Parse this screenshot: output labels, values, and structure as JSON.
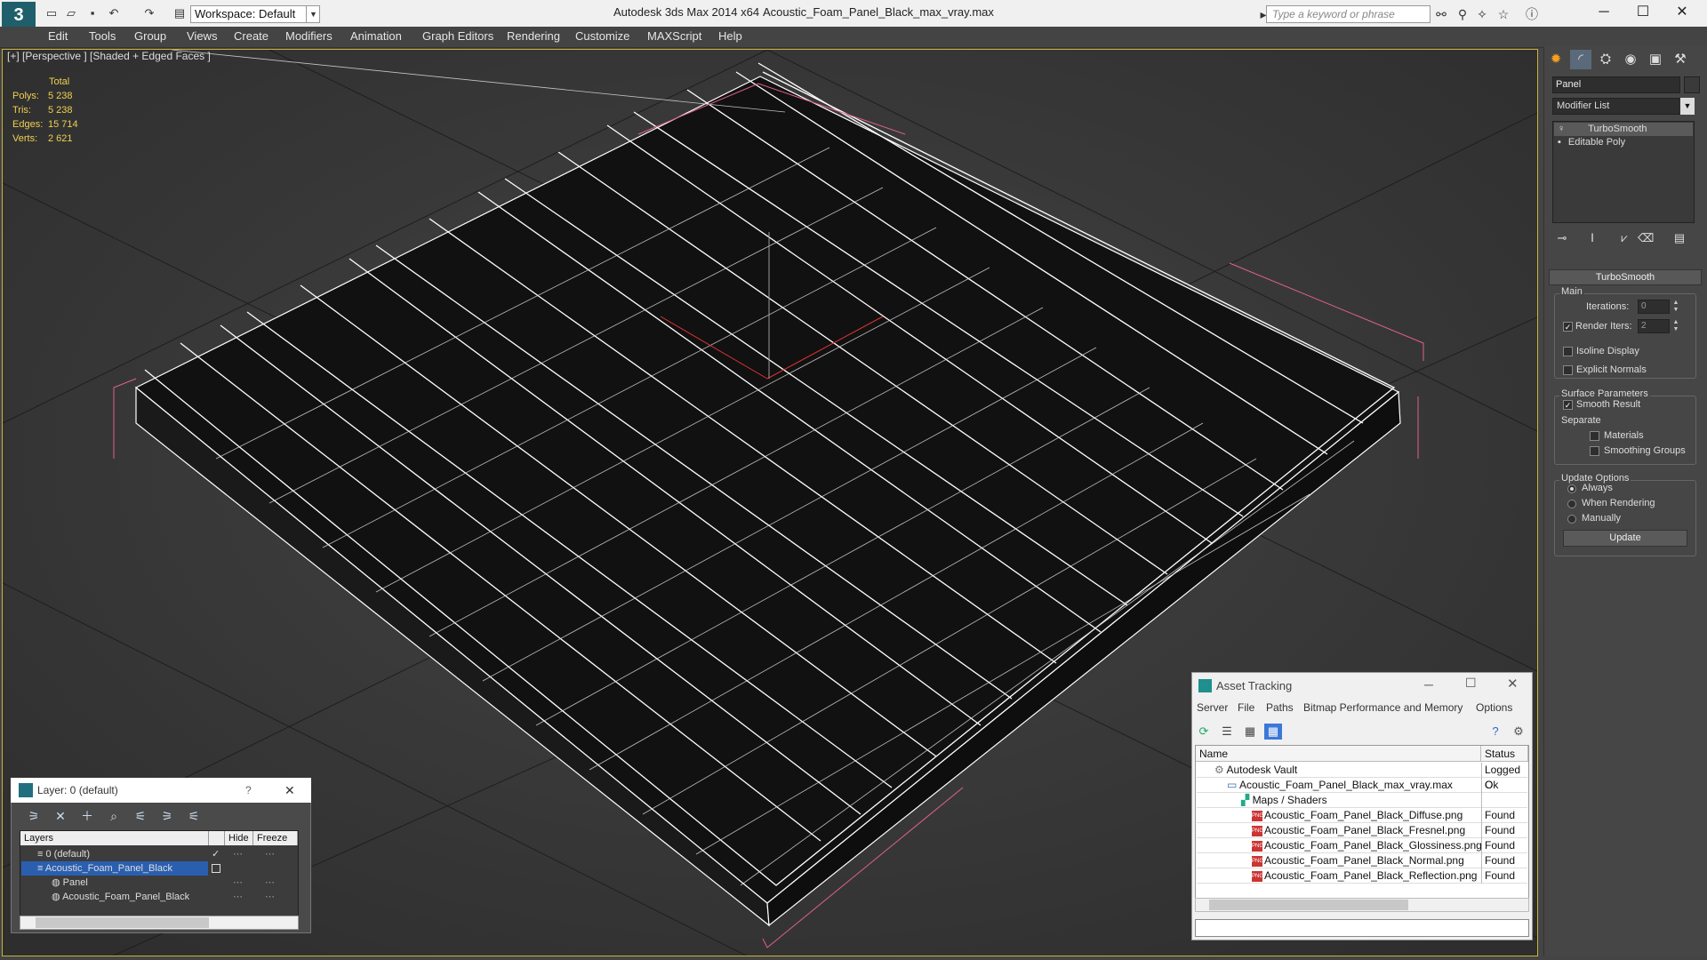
{
  "titlebar": {
    "app_title": "Autodesk 3ds Max  2014 x64",
    "file_title": "Acoustic_Foam_Panel_Black_max_vray.max",
    "workspace": "Workspace: Default",
    "search_placeholder": "Type a keyword or phrase"
  },
  "menu": [
    "Edit",
    "Tools",
    "Group",
    "Views",
    "Create",
    "Modifiers",
    "Animation",
    "Graph Editors",
    "Rendering",
    "Customize",
    "MAXScript",
    "Help"
  ],
  "viewport": {
    "label": "[+] [Perspective ] [Shaded + Edged Faces ]",
    "stats": {
      "header": "Total",
      "rows": [
        {
          "label": "Polys:",
          "value": "5 238"
        },
        {
          "label": "Tris:",
          "value": "5 238"
        },
        {
          "label": "Edges:",
          "value": "15 714"
        },
        {
          "label": "Verts:",
          "value": "2 621"
        }
      ]
    }
  },
  "command_panel": {
    "object_name": "Panel",
    "modifier_list": "Modifier List",
    "stack": [
      "TurboSmooth",
      "Editable Poly"
    ],
    "rollout_title": "TurboSmooth",
    "main": {
      "title": "Main",
      "iterations_label": "Iterations:",
      "iterations_value": "0",
      "render_iters_label": "Render Iters:",
      "render_iters_value": "2",
      "isoline_label": "Isoline Display",
      "explicit_label": "Explicit Normals"
    },
    "surface": {
      "title": "Surface Parameters",
      "smooth_label": "Smooth Result",
      "separate_label": "Separate",
      "materials_label": "Materials",
      "smoothing_groups_label": "Smoothing Groups"
    },
    "update": {
      "title": "Update Options",
      "always": "Always",
      "when_rendering": "When Rendering",
      "manually": "Manually",
      "button": "Update"
    }
  },
  "layer_dialog": {
    "title": "Layer: 0 (default)",
    "help": "?",
    "close": "✕",
    "columns": [
      "Layers",
      "Hide",
      "Freeze"
    ],
    "rows": [
      "0 (default)",
      "Acoustic_Foam_Panel_Black",
      "Panel",
      "Acoustic_Foam_Panel_Black"
    ]
  },
  "asset_tracking": {
    "title": "Asset Tracking",
    "menu": [
      "Server",
      "File",
      "Paths",
      "Bitmap Performance and Memory",
      "Options"
    ],
    "columns": [
      "Name",
      "Status"
    ],
    "rows": [
      {
        "name": "Autodesk Vault",
        "status": "Logged O"
      },
      {
        "name": "Acoustic_Foam_Panel_Black_max_vray.max",
        "status": "Ok"
      },
      {
        "name": "Maps / Shaders",
        "status": ""
      },
      {
        "name": "Acoustic_Foam_Panel_Black_Diffuse.png",
        "status": "Found"
      },
      {
        "name": "Acoustic_Foam_Panel_Black_Fresnel.png",
        "status": "Found"
      },
      {
        "name": "Acoustic_Foam_Panel_Black_Glossiness.png",
        "status": "Found"
      },
      {
        "name": "Acoustic_Foam_Panel_Black_Normal.png",
        "status": "Found"
      },
      {
        "name": "Acoustic_Foam_Panel_Black_Reflection.png",
        "status": "Found"
      }
    ]
  }
}
